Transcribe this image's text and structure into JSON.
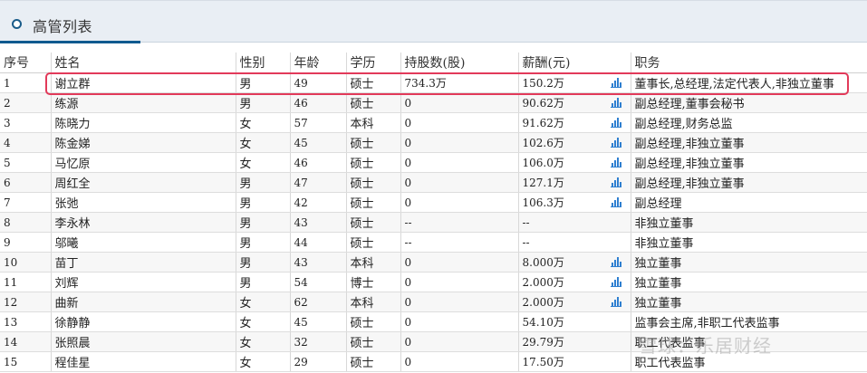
{
  "header": {
    "title": "高管列表"
  },
  "columns": [
    "序号",
    "姓名",
    "性别",
    "年龄",
    "学历",
    "持股数(股)",
    "薪酬(元)",
    "职务"
  ],
  "rows": [
    {
      "no": "1",
      "name": "谢立群",
      "gender": "男",
      "age": "49",
      "edu": "硕士",
      "shares": "734.3万",
      "salary": "150.2万",
      "chart": true,
      "title": "董事长,总经理,法定代表人,非独立董事"
    },
    {
      "no": "2",
      "name": "练源",
      "gender": "男",
      "age": "46",
      "edu": "硕士",
      "shares": "0",
      "salary": "90.62万",
      "chart": true,
      "title": "副总经理,董事会秘书"
    },
    {
      "no": "3",
      "name": "陈晓力",
      "gender": "女",
      "age": "57",
      "edu": "本科",
      "shares": "0",
      "salary": "91.62万",
      "chart": true,
      "title": "副总经理,财务总监"
    },
    {
      "no": "4",
      "name": "陈金娣",
      "gender": "女",
      "age": "45",
      "edu": "硕士",
      "shares": "0",
      "salary": "102.6万",
      "chart": true,
      "title": "副总经理,非独立董事"
    },
    {
      "no": "5",
      "name": "马忆原",
      "gender": "女",
      "age": "46",
      "edu": "硕士",
      "shares": "0",
      "salary": "106.0万",
      "chart": true,
      "title": "副总经理,非独立董事"
    },
    {
      "no": "6",
      "name": "周红全",
      "gender": "男",
      "age": "47",
      "edu": "硕士",
      "shares": "0",
      "salary": "127.1万",
      "chart": true,
      "title": "副总经理,非独立董事"
    },
    {
      "no": "7",
      "name": "张弛",
      "gender": "男",
      "age": "42",
      "edu": "硕士",
      "shares": "0",
      "salary": "106.3万",
      "chart": true,
      "title": "副总经理"
    },
    {
      "no": "8",
      "name": "李永林",
      "gender": "男",
      "age": "43",
      "edu": "硕士",
      "shares": "--",
      "salary": "--",
      "chart": false,
      "title": "非独立董事"
    },
    {
      "no": "9",
      "name": "邬曦",
      "gender": "男",
      "age": "44",
      "edu": "硕士",
      "shares": "--",
      "salary": "--",
      "chart": false,
      "title": "非独立董事"
    },
    {
      "no": "10",
      "name": "苗丁",
      "gender": "男",
      "age": "43",
      "edu": "本科",
      "shares": "0",
      "salary": "8.000万",
      "chart": true,
      "title": "独立董事"
    },
    {
      "no": "11",
      "name": "刘辉",
      "gender": "男",
      "age": "54",
      "edu": "博士",
      "shares": "0",
      "salary": "2.000万",
      "chart": true,
      "title": "独立董事"
    },
    {
      "no": "12",
      "name": "曲新",
      "gender": "女",
      "age": "62",
      "edu": "本科",
      "shares": "0",
      "salary": "2.000万",
      "chart": true,
      "title": "独立董事"
    },
    {
      "no": "13",
      "name": "徐静静",
      "gender": "女",
      "age": "45",
      "edu": "硕士",
      "shares": "0",
      "salary": "54.10万",
      "chart": false,
      "title": "监事会主席,非职工代表监事"
    },
    {
      "no": "14",
      "name": "张照晨",
      "gender": "女",
      "age": "32",
      "edu": "硕士",
      "shares": "0",
      "salary": "29.79万",
      "chart": false,
      "title": "职工代表监事"
    },
    {
      "no": "15",
      "name": "程佳星",
      "gender": "女",
      "age": "29",
      "edu": "硕士",
      "shares": "0",
      "salary": "17.50万",
      "chart": false,
      "title": "职工代表监事"
    }
  ],
  "highlight_row": "1",
  "chart_icon": "bar-chart-icon",
  "watermark": "雪球：乐居财经",
  "colors": {
    "accent": "#0f5a8f",
    "highlight": "#e23a5a",
    "icon": "#2f7fd0",
    "header_bg": "#e9eef4"
  }
}
